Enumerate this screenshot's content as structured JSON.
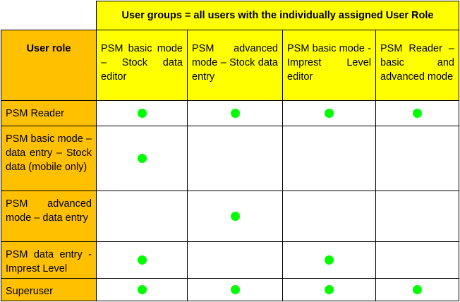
{
  "table": {
    "group_header": "User groups = all users with the individually assigned User Role",
    "role_header": "User role",
    "columns": [
      "PSM basic mode – Stock data editor",
      "PSM advanced mode – Stock data entry",
      "PSM basic mode - Imprest Level editor",
      "PSM Reader – basic and advanced mode"
    ],
    "rows": [
      {
        "label": "PSM Reader",
        "marks": [
          true,
          true,
          true,
          true
        ]
      },
      {
        "label": "PSM basic mode – data entry – Stock data (mobile only)",
        "marks": [
          true,
          false,
          false,
          false
        ]
      },
      {
        "label": "PSM advanced mode – data entry",
        "marks": [
          false,
          true,
          false,
          false
        ]
      },
      {
        "label": "PSM data entry - Imprest Level",
        "marks": [
          true,
          false,
          true,
          false
        ]
      },
      {
        "label": "Superuser",
        "marks": [
          true,
          true,
          true,
          true
        ]
      }
    ],
    "mark_color": "#00ff00",
    "header_yellow": "#ffff00",
    "label_orange": "#ffc000"
  }
}
